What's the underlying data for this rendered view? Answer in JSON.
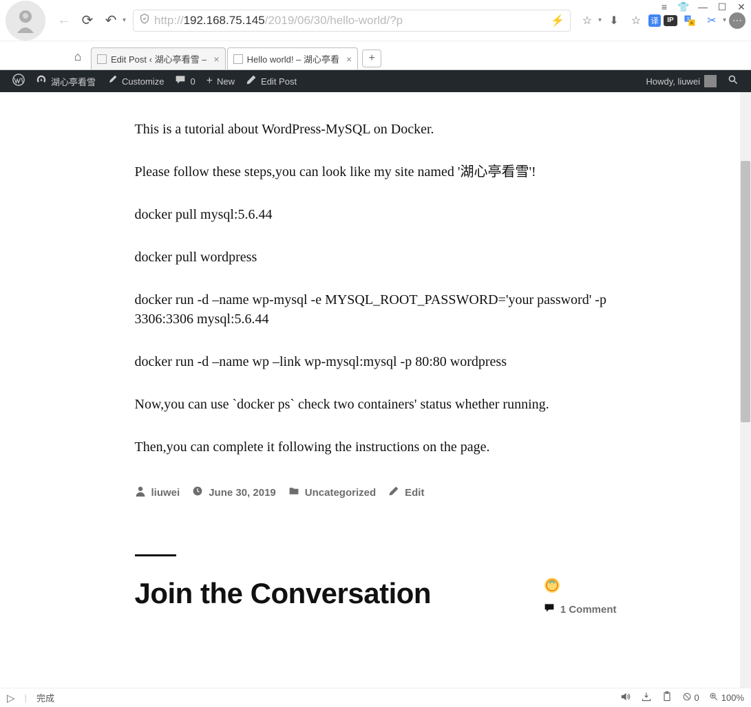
{
  "browser": {
    "url_prefix": "http://",
    "url_host": "192.168.75.145",
    "url_path": "/2019/06/30/hello-world/?p",
    "tabs": [
      {
        "title": "Edit Post ‹ 湖心亭看雪 –",
        "active": false
      },
      {
        "title": "Hello world! – 湖心亭看",
        "active": true
      }
    ]
  },
  "wp_bar": {
    "site_name": "湖心亭看雪",
    "customize": "Customize",
    "comments_count": "0",
    "new": "New",
    "edit_post": "Edit Post",
    "howdy": "Howdy, liuwei"
  },
  "post": {
    "paragraphs": [
      "This is a tutorial about WordPress-MySQL on Docker.",
      "Please follow these steps,you can look like my site named '湖心亭看雪'!",
      "docker pull mysql:5.6.44",
      "docker pull wordpress",
      "docker run -d –name wp-mysql -e MYSQL_ROOT_PASSWORD='your password' -p 3306:3306 mysql:5.6.44",
      "docker run -d –name wp  –link wp-mysql:mysql -p 80:80 wordpress",
      "Now,you can use `docker ps` check two containers' status whether running.",
      "Then,you can complete it following the instructions on the page."
    ],
    "meta": {
      "author": "liuwei",
      "date": "June 30, 2019",
      "category": "Uncategorized",
      "edit": "Edit"
    }
  },
  "comments": {
    "heading": "Join the Conversation",
    "count_label": "1 Comment"
  },
  "status": {
    "left_label": "完成",
    "block_count": "0",
    "zoom": "100%"
  }
}
